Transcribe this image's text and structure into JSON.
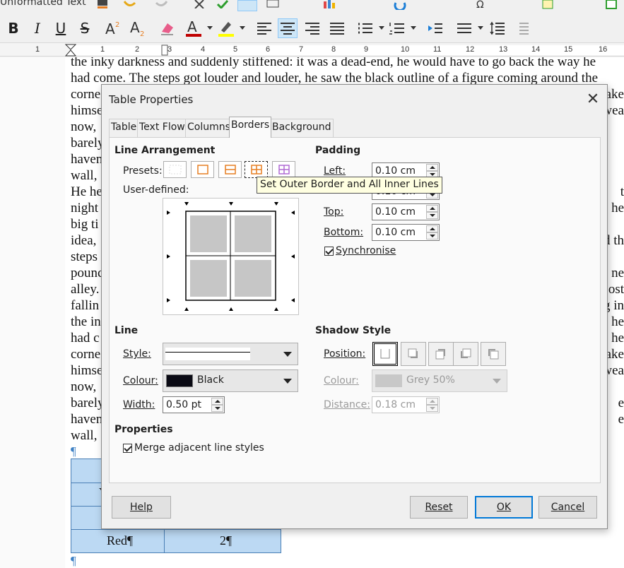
{
  "toolbar": {
    "paragraph_style_value": "Unformatted Text",
    "bold_icon_glyph": "B",
    "italic_icon_glyph": "I",
    "underline_icon_glyph": "U",
    "strike_icon_glyph": "S",
    "font_color_glyph": "A",
    "accent_font_color": "#c00000",
    "highlight_color": "#ffff00"
  },
  "ruler": {
    "numbers": [
      "1",
      "1",
      "2",
      "3",
      "4",
      "5",
      "6",
      "7",
      "8",
      "9",
      "10",
      "11",
      "12",
      "13",
      "14",
      "15",
      "16"
    ]
  },
  "document": {
    "lines_full": [
      "the inky darkness and suddenly stiffened: it was a dead-end, he would have to go back the way he",
      "had come. The steps got louder and louder, he saw the black outline of a figure coming around the"
    ],
    "left_fragments": [
      "corne",
      "himse",
      "now,",
      "barely",
      "haven",
      "wall,",
      "He he",
      "night",
      "big ti",
      "idea,",
      "steps",
      "pounc",
      "alley.",
      "fallin",
      "the in",
      "had c",
      "corne",
      "himse",
      "now,",
      "barely",
      "haven",
      "wall,"
    ],
    "right_fragments": [
      "ake",
      "wea",
      "",
      "",
      "",
      "",
      "t",
      "he",
      "",
      "d th",
      "",
      "ne",
      "ost",
      "g in",
      "he",
      "he",
      "ake",
      "wea",
      "",
      "e",
      "e",
      ""
    ],
    "pilcrow": "¶",
    "table_cells": {
      "partial_letter": "Y",
      "row_red_label": "Red¶",
      "row_red_value": "2¶"
    }
  },
  "dialog": {
    "title": "Table Properties",
    "close_glyph": "✕",
    "tabs": [
      "Table",
      "Text Flow",
      "Columns",
      "Borders",
      "Background"
    ],
    "selected_tab": "Borders",
    "line_arrangement": {
      "header": "Line Arrangement",
      "presets_label": "Presets:",
      "user_defined_label": "User-defined:",
      "tooltip": "Set Outer Border and All Inner Lines"
    },
    "padding": {
      "header": "Padding",
      "left_label": "Left:",
      "left_value": "0.10 cm",
      "right_value": "0.10 cm",
      "top_label": "Top:",
      "top_value": "0.10 cm",
      "bottom_label": "Bottom:",
      "bottom_value": "0.10 cm",
      "synchronise_label": "Synchronise",
      "synchronise_checked": true
    },
    "line": {
      "header": "Line",
      "style_label": "Style:",
      "colour_label": "Colour:",
      "colour_value": "Black",
      "colour_swatch": "#0a0a14",
      "width_label": "Width:",
      "width_value": "0.50 pt"
    },
    "shadow": {
      "header": "Shadow Style",
      "position_label": "Position:",
      "colour_label": "Colour:",
      "colour_value": "Grey 50%",
      "colour_swatch": "#c8c8c8",
      "distance_label": "Distance:",
      "distance_value": "0.18 cm"
    },
    "properties": {
      "header": "Properties",
      "merge_label": "Merge adjacent line styles",
      "merge_checked": true
    },
    "buttons": {
      "help": "Help",
      "reset": "Reset",
      "ok": "OK",
      "cancel": "Cancel"
    }
  }
}
